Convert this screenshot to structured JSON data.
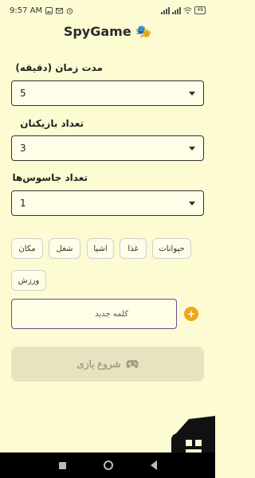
{
  "status_bar": {
    "time": "9:57 AM",
    "battery": "49"
  },
  "app": {
    "title": "SpyGame",
    "title_emoji": "🎭"
  },
  "fields": [
    {
      "label": "مدت زمان (دقیقه)",
      "value": "5"
    },
    {
      "label": "تعداد بازیکنان",
      "value": "3"
    },
    {
      "label": "تعداد جاسوس‌ها",
      "value": "1"
    }
  ],
  "categories": [
    "حیوانات",
    "غذا",
    "اشیا",
    "شغل",
    "مکان",
    "ورزش"
  ],
  "new_word": {
    "placeholder": "کلمه جدید",
    "value": ""
  },
  "start_button": {
    "label": "شروع بازی",
    "icon": "gamepad-icon"
  },
  "colors": {
    "background": "#fdfbd2",
    "accent": "#f2a51a",
    "input_border": "#6a4c93",
    "disabled_button": "#e6e4c0"
  }
}
